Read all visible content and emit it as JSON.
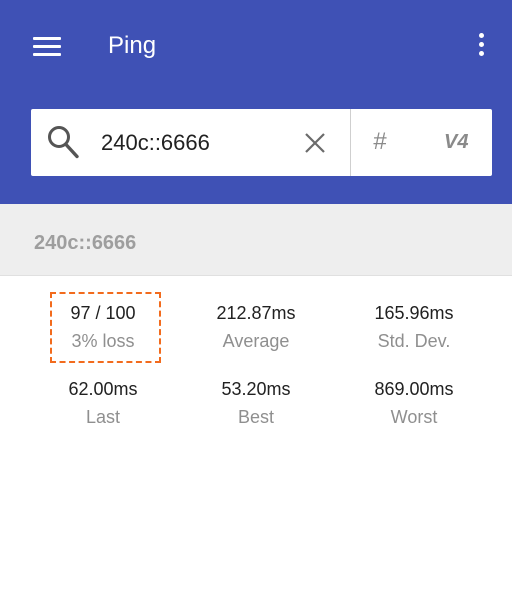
{
  "toolbar": {
    "title": "Ping"
  },
  "search": {
    "value": "240c::6666",
    "hash_label": "#",
    "ip_version_label": "V4"
  },
  "host": {
    "name": "240c::6666"
  },
  "stats": {
    "received": {
      "value": "97 / 100",
      "label": "3% loss"
    },
    "average": {
      "value": "212.87ms",
      "label": "Average"
    },
    "std_dev": {
      "value": "165.96ms",
      "label": "Std. Dev."
    },
    "last": {
      "value": "62.00ms",
      "label": "Last"
    },
    "best": {
      "value": "53.20ms",
      "label": "Best"
    },
    "worst": {
      "value": "869.00ms",
      "label": "Worst"
    }
  },
  "colors": {
    "appbar": "#3f51b5",
    "highlight_border": "#f26b1d",
    "header_bg": "#eeeeee"
  }
}
